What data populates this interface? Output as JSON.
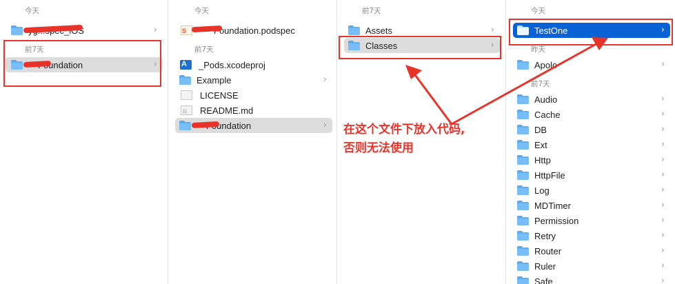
{
  "columns": [
    {
      "sections": [
        {
          "header": "今天",
          "items": [
            {
              "icon": "folder-icon",
              "label": "yg...spec_iOS",
              "chevron": true
            }
          ]
        },
        {
          "header": "前7天",
          "items": [
            {
              "icon": "folder-icon",
              "label": "Foundation",
              "chevron": true,
              "selected": "gray"
            }
          ]
        }
      ]
    },
    {
      "sections": [
        {
          "header": "今天",
          "items": [
            {
              "icon": "swift-file-icon",
              "label": "Foundation.podspec"
            }
          ]
        },
        {
          "header": "前7天",
          "items": [
            {
              "icon": "xcodeproj-icon",
              "label": "_Pods.xcodeproj"
            },
            {
              "icon": "folder-icon",
              "label": "Example",
              "chevron": true
            },
            {
              "icon": "document-icon",
              "label": "LICENSE"
            },
            {
              "icon": "markdown-document-icon",
              "label": "README.md"
            },
            {
              "icon": "folder-icon",
              "label": "Foundation",
              "chevron": true,
              "selected": "gray"
            }
          ]
        }
      ]
    },
    {
      "sections": [
        {
          "header": "前7天",
          "items": [
            {
              "icon": "folder-icon",
              "label": "Assets",
              "chevron": true
            },
            {
              "icon": "folder-icon",
              "label": "Classes",
              "chevron": true,
              "selected": "gray"
            }
          ]
        }
      ]
    },
    {
      "sections": [
        {
          "header": "今天",
          "items": [
            {
              "icon": "folder-icon",
              "label": "TestOne",
              "chevron": true,
              "selected": "blue"
            }
          ]
        },
        {
          "header": "昨天",
          "items": [
            {
              "icon": "folder-icon",
              "label": "Apolo",
              "chevron": true
            }
          ]
        },
        {
          "header": "前7天",
          "items": [
            {
              "icon": "folder-icon",
              "label": "Audio",
              "chevron": true
            },
            {
              "icon": "folder-icon",
              "label": "Cache",
              "chevron": true
            },
            {
              "icon": "folder-icon",
              "label": "DB",
              "chevron": true
            },
            {
              "icon": "folder-icon",
              "label": "Ext",
              "chevron": true
            },
            {
              "icon": "folder-icon",
              "label": "Http",
              "chevron": true
            },
            {
              "icon": "folder-icon",
              "label": "HttpFile",
              "chevron": true
            },
            {
              "icon": "folder-icon",
              "label": "Log",
              "chevron": true
            },
            {
              "icon": "folder-icon",
              "label": "MDTimer",
              "chevron": true
            },
            {
              "icon": "folder-icon",
              "label": "Permission",
              "chevron": true
            },
            {
              "icon": "folder-icon",
              "label": "Retry",
              "chevron": true
            },
            {
              "icon": "folder-icon",
              "label": "Router",
              "chevron": true
            },
            {
              "icon": "folder-icon",
              "label": "Ruler",
              "chevron": true
            },
            {
              "icon": "folder-icon",
              "label": "Safe",
              "chevron": true
            }
          ]
        }
      ]
    }
  ],
  "chevron_glyph": "›",
  "annotation": {
    "line1": "在这个文件下放入代码,",
    "line2": "否则无法使用",
    "color": "#e8332a"
  },
  "colors": {
    "selection_gray": "#dcdcdc",
    "selection_blue": "#0a63d6",
    "folder": "#5fb0f0",
    "annotation_red": "#e8332a"
  }
}
